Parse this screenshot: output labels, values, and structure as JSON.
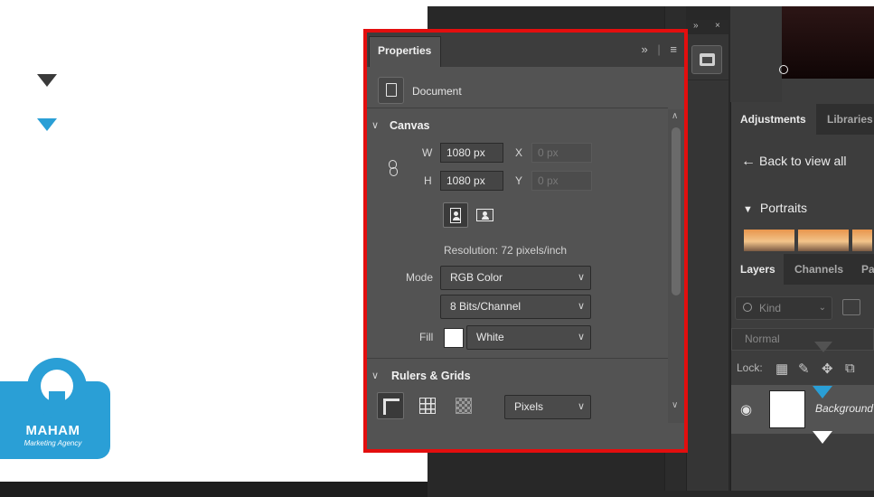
{
  "slide": {
    "logo": {
      "title": "MAHAM",
      "subtitle": "Marketing Agency"
    }
  },
  "properties": {
    "tab": "Properties",
    "head_icons": [
      "expand-icon",
      "menu-icon"
    ],
    "document_label": "Document",
    "canvas": {
      "title": "Canvas",
      "w_label": "W",
      "w_value": "1080 px",
      "h_label": "H",
      "h_value": "1080 px",
      "x_label": "X",
      "x_placeholder": "0 px",
      "y_label": "Y",
      "y_placeholder": "0 px",
      "resolution": "Resolution: 72 pixels/inch",
      "mode_label": "Mode",
      "mode_value": "RGB Color",
      "bits_value": "8 Bits/Channel",
      "fill_label": "Fill",
      "fill_value": "White",
      "fill_color": "#ffffff"
    },
    "rulers": {
      "title": "Rulers & Grids",
      "units_value": "Pixels"
    }
  },
  "right_panel": {
    "adjustments_tabs": [
      "Adjustments",
      "Libraries"
    ],
    "back_label": "Back to view all",
    "portraits_label": "Portraits",
    "layers_tabs": [
      "Layers",
      "Channels",
      "Pa"
    ],
    "kind_placeholder": "Kind",
    "blend_mode": "Normal",
    "lock_label": "Lock:",
    "layer_name": "Background"
  },
  "mini_panel": {
    "expand": "»",
    "close": "×"
  },
  "colors": {
    "accent": "#2a9fd6",
    "highlight": "#e30e0e",
    "panel": "#535353"
  }
}
